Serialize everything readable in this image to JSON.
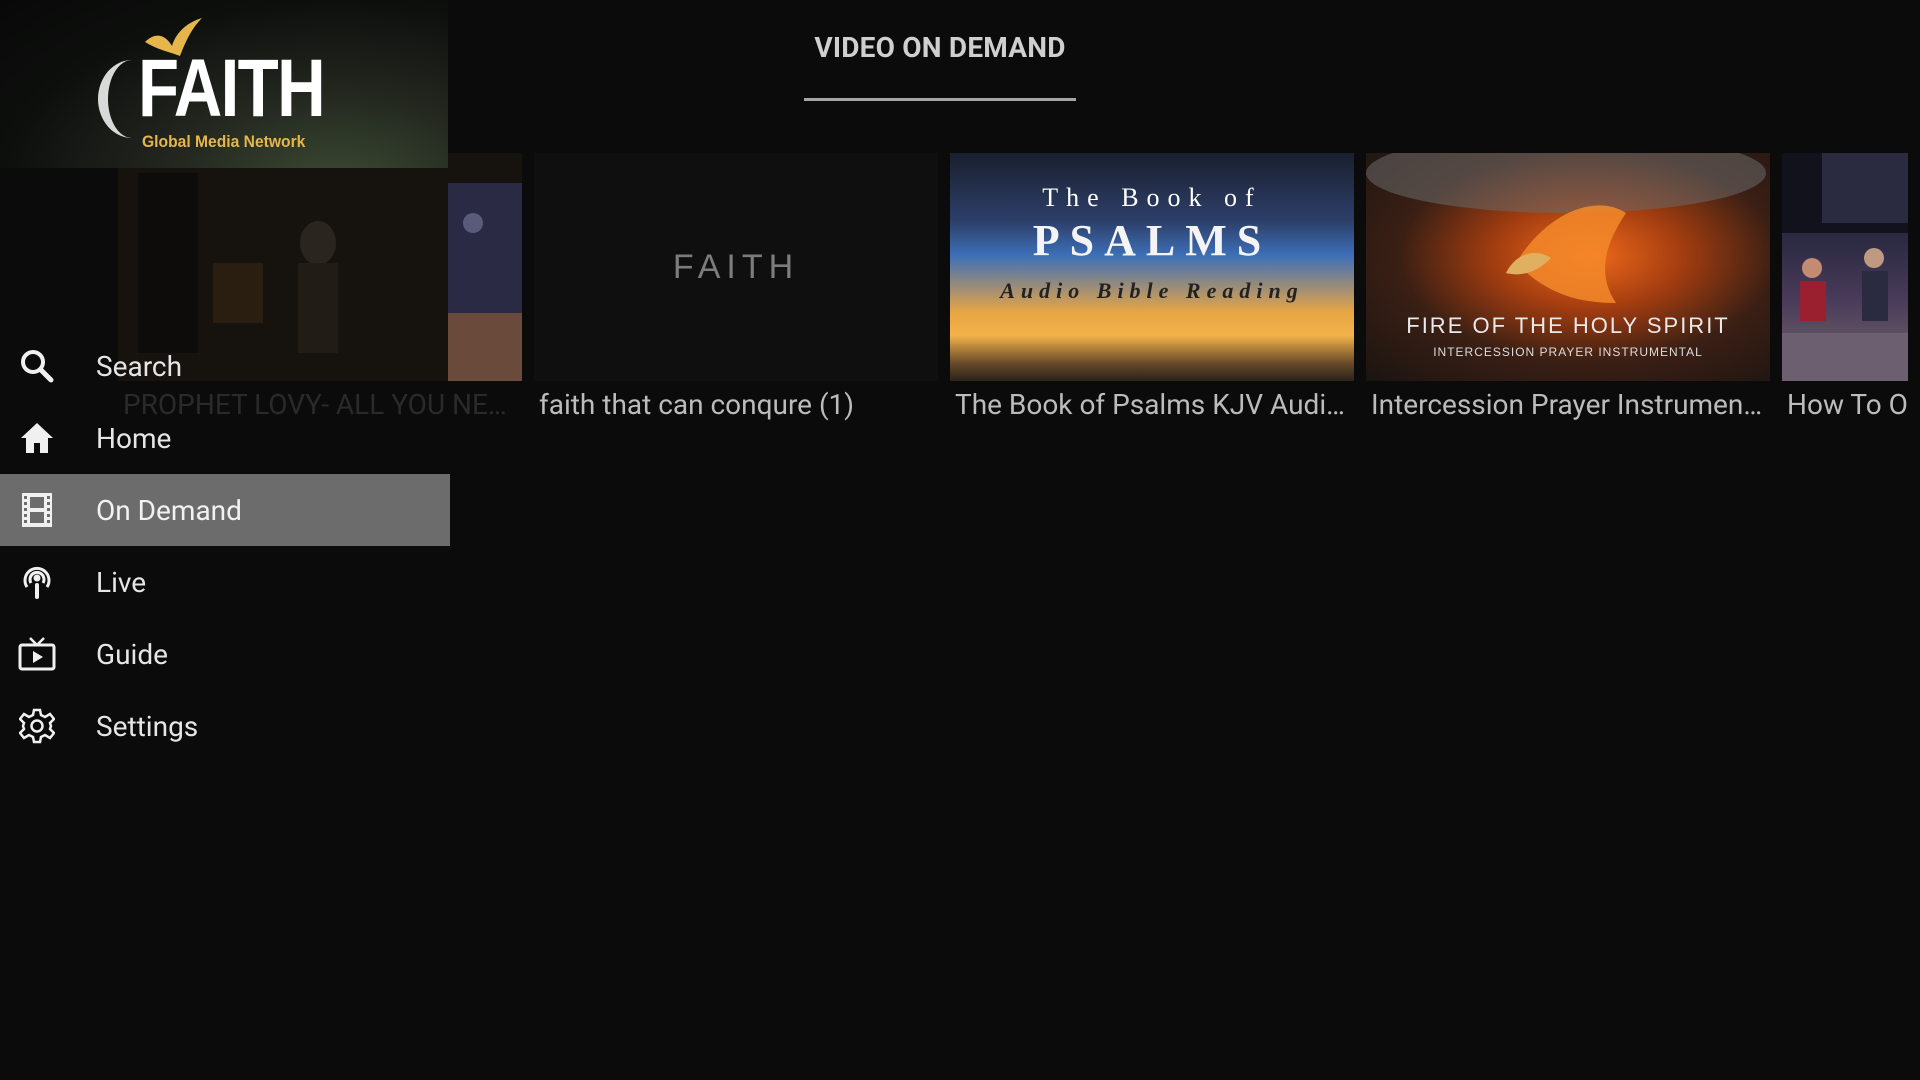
{
  "header": {
    "title": "VIDEO ON DEMAND"
  },
  "logo": {
    "brand": "FAITH",
    "subtitle": "Global Media Network"
  },
  "nav": {
    "items": [
      {
        "label": "Search",
        "icon": "search-icon"
      },
      {
        "label": "Home",
        "icon": "home-icon"
      },
      {
        "label": "On Demand",
        "icon": "film-icon",
        "active": true
      },
      {
        "label": "Live",
        "icon": "podcast-icon"
      },
      {
        "label": "Guide",
        "icon": "tv-icon"
      },
      {
        "label": "Settings",
        "icon": "gear-icon"
      }
    ]
  },
  "videos": [
    {
      "title": "PROPHET LOVY- ALL YOU NE…"
    },
    {
      "title": "faith that can conqure  (1)",
      "thumb_text": "FAITH"
    },
    {
      "title": "The Book of Psalms KJV Audi…",
      "thumb_top": "The Book of",
      "thumb_mid": "PSALMS",
      "thumb_bot": "Audio Bible Reading"
    },
    {
      "title": "Intercession Prayer Instrumen…",
      "thumb_title": "FIRE OF THE HOLY SPIRIT",
      "thumb_sub": "INTERCESSION PRAYER INSTRUMENTAL"
    },
    {
      "title": "How To O"
    }
  ],
  "colors": {
    "background": "#0b0b0c",
    "nav_active": "#6c6c6c",
    "brand_gold": "#e7b64a"
  }
}
